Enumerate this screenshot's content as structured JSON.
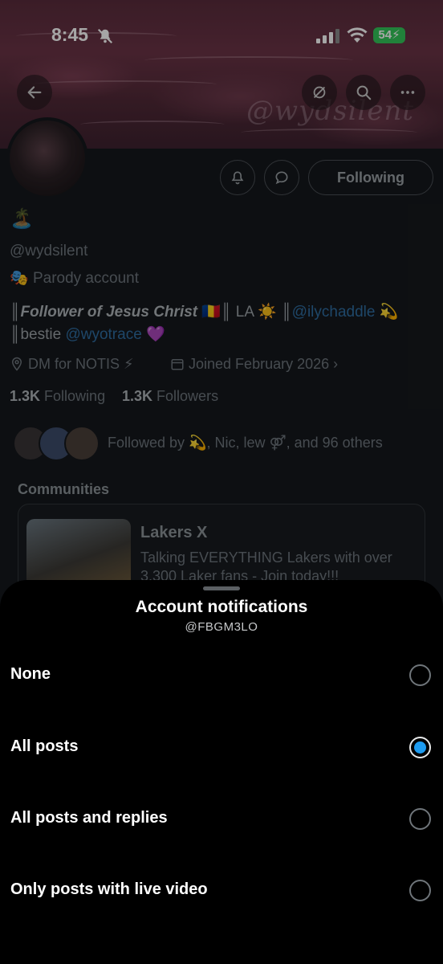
{
  "status_bar": {
    "time": "8:45",
    "battery": "54"
  },
  "banner": {
    "watermark": "@wydsilent"
  },
  "profile": {
    "emoji": "🏝️",
    "handle": "@wydsilent",
    "parody_label": "Parody account",
    "bio_prefix": "║",
    "bio_bold": "Follower of Jesus Christ",
    "bio_mid": " 🇷🇴║ LA ☀️ ║",
    "bio_mention1": "@ilychaddle",
    "bio_line1_end": " 💫",
    "bio_line2_start": "║bestie ",
    "bio_mention2": "@wyotrace",
    "bio_line2_end": " 💜",
    "location": "DM for NOTIS ⚡",
    "joined": "Joined February 2026",
    "following_count": "1.3K",
    "following_label": "Following",
    "followers_count": "1.3K",
    "followers_label": "Followers",
    "followed_by": "Followed by 💫, Nic, lew ⚤, and 96 others",
    "following_button": "Following"
  },
  "communities": {
    "heading": "Communities",
    "name": "Lakers X",
    "description_1": "Talking EVERYTHING Lakers with over",
    "description_2": "3,300 Laker fans - Join today!!!"
  },
  "sheet": {
    "title": "Account notifications",
    "subtitle": "@FBGM3LO",
    "options": [
      {
        "label": "None",
        "selected": false
      },
      {
        "label": "All posts",
        "selected": true
      },
      {
        "label": "All posts and replies",
        "selected": false
      },
      {
        "label": "Only posts with live video",
        "selected": false
      }
    ]
  },
  "colors": {
    "accent": "#1d9bf0",
    "battery": "#34c759"
  }
}
